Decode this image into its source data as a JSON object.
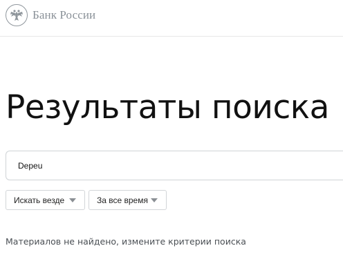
{
  "header": {
    "logo_text": "Банк России",
    "logo_icon": "double-headed-eagle-emblem"
  },
  "main": {
    "title": "Результаты поиска",
    "search": {
      "value": "Depeu",
      "placeholder": ""
    },
    "filters": {
      "where": {
        "selected": "Искать везде",
        "icon": "chevron-down-icon"
      },
      "time": {
        "selected": "За все время",
        "icon": "chevron-down-icon"
      }
    },
    "empty_message": "Материалов не найдено, измените критерии поиска"
  },
  "colors": {
    "logo": "#8a9198",
    "title": "#111111",
    "border": "#cfd3d6",
    "muted_text": "#4a4f54"
  }
}
